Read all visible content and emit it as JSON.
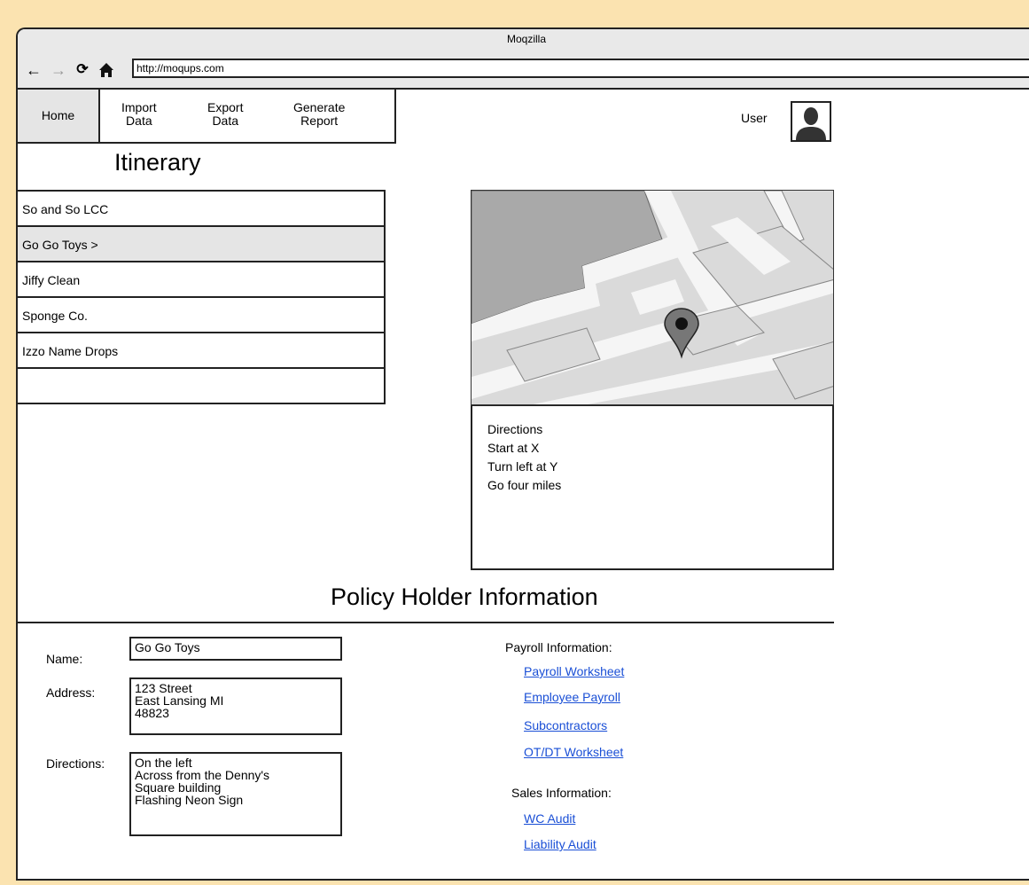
{
  "window": {
    "title": "Moqzilla",
    "url": "http://moqups.com"
  },
  "nav_icons": [
    "back-arrow-icon",
    "forward-arrow-icon",
    "reload-icon",
    "home-icon"
  ],
  "menu": {
    "home": "Home",
    "import": "Import\nData",
    "export": "Export\nData",
    "generate": "Generate\nReport"
  },
  "user": {
    "label": "User"
  },
  "itinerary": {
    "title": "Itinerary",
    "items": [
      {
        "label": "So and So LCC"
      },
      {
        "label": "Go Go Toys >"
      },
      {
        "label": "Jiffy Clean"
      },
      {
        "label": "Sponge Co."
      },
      {
        "label": "Izzo Name Drops"
      },
      {
        "label": ""
      }
    ]
  },
  "directions": {
    "lines": [
      "Directions",
      "Start at X",
      "Turn left at Y",
      "Go four miles"
    ]
  },
  "policy": {
    "title": "Policy Holder Information",
    "name_label": "Name:",
    "name_value": "Go Go Toys",
    "address_label": "Address:",
    "address_value": "123 Street\nEast Lansing MI\n48823",
    "directions_label": "Directions:",
    "directions_value": "On the left\nAcross from the Denny's\nSquare building\nFlashing Neon Sign",
    "payroll_label": "Payroll Information:",
    "payroll_links": [
      "Payroll Worksheet",
      "Employee Payroll",
      "Subcontractors",
      "OT/DT Worksheet"
    ],
    "sales_label": "Sales Information:",
    "sales_links": [
      "WC Audit",
      "Liability Audit"
    ]
  },
  "colors": {
    "background": "#fbe3b0",
    "link": "#1a4fd6",
    "selected": "#e5e5e5"
  }
}
